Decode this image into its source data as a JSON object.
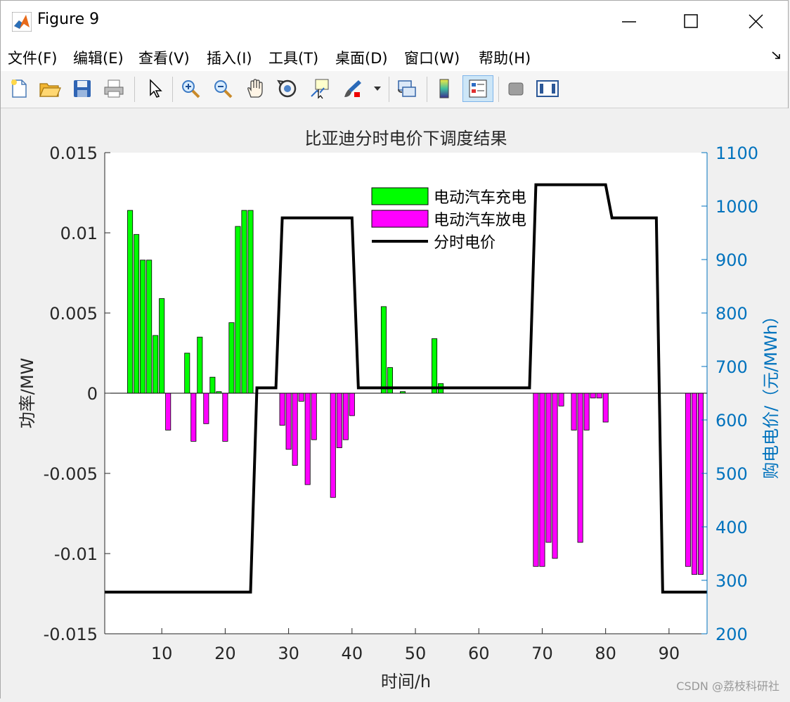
{
  "window": {
    "title": "Figure 9"
  },
  "menu": [
    {
      "label": "文件(F)"
    },
    {
      "label": "编辑(E)"
    },
    {
      "label": "查看(V)"
    },
    {
      "label": "插入(I)"
    },
    {
      "label": "工具(T)"
    },
    {
      "label": "桌面(D)"
    },
    {
      "label": "窗口(W)"
    },
    {
      "label": "帮助(H)"
    }
  ],
  "toolbar_icons": [
    "new-figure-icon",
    "open-file-icon",
    "save-icon",
    "print-icon",
    "pointer-icon",
    "zoom-in-icon",
    "zoom-out-icon",
    "pan-icon",
    "rotate-3d-icon",
    "data-cursor-icon",
    "brush-icon",
    "brush-dropdown-icon",
    "link-plot-icon",
    "colorbar-icon",
    "legend-icon",
    "hide-plot-tools-icon",
    "show-plot-tools-icon"
  ],
  "colors": {
    "charge": "#00ff00",
    "discharge": "#ff00ff",
    "price": "#000000",
    "right_axis": "#0072bd"
  },
  "chart_data": {
    "type": "bar",
    "title": "比亚迪分时电价下调度结果",
    "xlabel": "时间/h",
    "ylabel_left": "功率/MW",
    "ylabel_right": "购电电价/（元/MWh）",
    "xlim": [
      1,
      96
    ],
    "ylim_left": [
      -0.015,
      0.015
    ],
    "ylim_right": [
      200,
      1100
    ],
    "xticks": [
      10,
      20,
      30,
      40,
      50,
      60,
      70,
      80,
      90
    ],
    "xtick_labels": [
      "10",
      "20",
      "30",
      "40",
      "50",
      "60",
      "70",
      "80",
      "90"
    ],
    "yticks_left": [
      0.015,
      0.01,
      0.005,
      0,
      -0.005,
      -0.01,
      -0.015
    ],
    "ytick_labels_left": [
      "0.015",
      "0.01",
      "0.005",
      "0",
      "-0.005",
      "-0.01",
      "-0.015"
    ],
    "yticks_right": [
      1100,
      1000,
      900,
      800,
      700,
      600,
      500,
      400,
      300,
      200
    ],
    "ytick_labels_right": [
      "1100",
      "1000",
      "900",
      "800",
      "700",
      "600",
      "500",
      "400",
      "300",
      "200"
    ],
    "legend": {
      "placement": "top-center",
      "entries": [
        "电动汽车充电",
        "电动汽车放电",
        "分时电价"
      ]
    },
    "series": [
      {
        "name": "电动汽车充电",
        "type": "bar",
        "x": [
          5,
          6,
          7,
          8,
          9,
          10,
          14,
          16,
          18,
          19,
          21,
          22,
          23,
          24,
          45,
          46,
          48,
          53,
          54
        ],
        "values": [
          0.0114,
          0.0099,
          0.0083,
          0.0083,
          0.0036,
          0.0059,
          0.0025,
          0.0035,
          0.001,
          0.0001,
          0.0044,
          0.0104,
          0.0114,
          0.0114,
          0.0054,
          0.0016,
          0.0001,
          0.0034,
          0.0006
        ]
      },
      {
        "name": "电动汽车放电",
        "type": "bar",
        "x": [
          11,
          15,
          17,
          20,
          29,
          30,
          31,
          32,
          33,
          34,
          37,
          38,
          39,
          40,
          69,
          70,
          71,
          72,
          73,
          75,
          76,
          77,
          78,
          79,
          80,
          93,
          94,
          95
        ],
        "values": [
          -0.0023,
          -0.003,
          -0.0019,
          -0.003,
          -0.002,
          -0.0035,
          -0.0045,
          -0.0005,
          -0.0057,
          -0.0029,
          -0.0065,
          -0.0034,
          -0.0029,
          -0.0014,
          -0.0108,
          -0.0108,
          -0.0093,
          -0.0103,
          -0.0008,
          -0.0023,
          -0.0093,
          -0.0023,
          -0.0003,
          -0.0003,
          -0.0018,
          -0.0108,
          -0.0113,
          -0.0113
        ]
      },
      {
        "name": "分时电价",
        "type": "line",
        "axis": "right",
        "x": [
          1,
          24,
          25,
          28,
          29,
          40,
          41,
          68,
          69,
          80,
          81,
          88,
          89,
          96
        ],
        "values": [
          278,
          278,
          660,
          660,
          978,
          978,
          660,
          660,
          1040,
          1040,
          978,
          978,
          278,
          278
        ]
      }
    ]
  },
  "watermark": "CSDN @荔枝科研社"
}
